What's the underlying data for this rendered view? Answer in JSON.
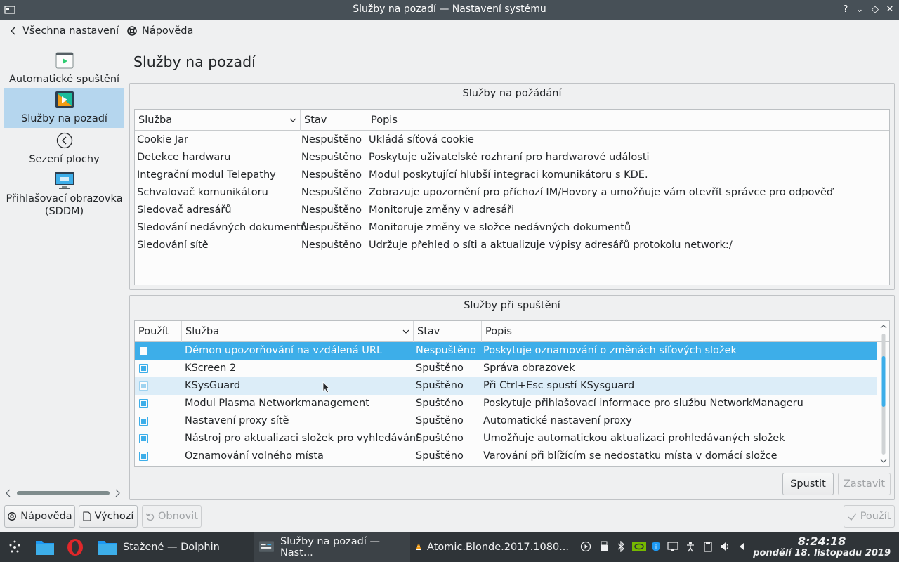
{
  "window": {
    "title": "Služby na pozadí — Nastavení systému",
    "controls": [
      "?",
      "⌄",
      "◇",
      "✕"
    ]
  },
  "topnav": {
    "back_label": "Všechna nastavení",
    "help_label": "Nápověda"
  },
  "sidebar": {
    "items": [
      {
        "label": "Automatické spuštění",
        "icon": "autostart-icon"
      },
      {
        "label": "Služby na pozadí",
        "icon": "background-services-icon",
        "active": true
      },
      {
        "label": "Sezení plochy",
        "icon": "session-icon"
      },
      {
        "label": "Přihlašovací obrazovka (SDDM)",
        "icon": "login-screen-icon"
      }
    ]
  },
  "page": {
    "title": "Služby na pozadí"
  },
  "on_demand": {
    "title": "Služby na požádání",
    "headers": {
      "service": "Služba",
      "state": "Stav",
      "desc": "Popis"
    },
    "rows": [
      {
        "service": "Cookie Jar",
        "state": "Nespuštěno",
        "desc": "Ukládá síťová cookie"
      },
      {
        "service": "Detekce hardwaru",
        "state": "Nespuštěno",
        "desc": "Poskytuje uživatelské rozhraní pro hardwarové události"
      },
      {
        "service": "Integrační modul Telepathy",
        "state": "Nespuštěno",
        "desc": "Modul poskytující hlubší integraci komunikátoru s KDE."
      },
      {
        "service": "Schvalovač komunikátoru",
        "state": "Nespuštěno",
        "desc": "Zobrazuje upozornění pro příchozí IM/Hovory a umožňuje vám otevřít správce pro odpověď"
      },
      {
        "service": "Sledovač adresářů",
        "state": "Nespuštěno",
        "desc": "Monitoruje změny v adresáři"
      },
      {
        "service": "Sledování nedávných dokumentů",
        "state": "Nespuštěno",
        "desc": "Monitoruje změny ve složce nedávných dokumentů"
      },
      {
        "service": "Sledování sítě",
        "state": "Nespuštěno",
        "desc": "Udržuje přehled o síti a aktualizuje výpisy adresářů protokolu network:/"
      }
    ]
  },
  "startup": {
    "title": "Služby při spuštění",
    "headers": {
      "use": "Použít",
      "service": "Služba",
      "state": "Stav",
      "desc": "Popis"
    },
    "rows": [
      {
        "use": false,
        "service": "Démon upozorňování na vzdálená URL",
        "state": "Nespuštěno",
        "desc": "Poskytuje oznamování o změnách síťových složek"
      },
      {
        "use": true,
        "service": "KScreen 2",
        "state": "Spuštěno",
        "desc": "Správa obrazovek"
      },
      {
        "use": true,
        "service": "KSysGuard",
        "state": "Spuštěno",
        "desc": "Při Ctrl+Esc spustí KSysguard"
      },
      {
        "use": true,
        "service": "Modul Plasma Networkmanagement",
        "state": "Spuštěno",
        "desc": "Poskytuje přihlašovací informace pro službu NetworkManageru"
      },
      {
        "use": true,
        "service": "Nastavení proxy sítě",
        "state": "Spuštěno",
        "desc": "Automatické nastavení proxy"
      },
      {
        "use": true,
        "service": "Nástroj pro aktualizaci složek pro vyhledávání",
        "state": "Spuštěno",
        "desc": "Umožňuje automatickou aktualizaci prohledávaných složek"
      },
      {
        "use": true,
        "service": "Oznamování volného místa",
        "state": "Spuštěno",
        "desc": "Varování při blížícím se nedostatku místa v domácí složce"
      }
    ],
    "start_label": "Spustit",
    "stop_label": "Zastavit"
  },
  "footer": {
    "help_label": "Nápověda",
    "defaults_label": "Výchozí",
    "reset_label": "Obnovit",
    "apply_label": "Použít"
  },
  "taskbar": {
    "tasks": [
      {
        "label": "Stažené — Dolphin"
      },
      {
        "label": "Služby na pozadí  — Nast..."
      },
      {
        "label": "Atomic.Blonde.2017.1080..."
      }
    ],
    "time": "8:24:18",
    "date": "pondělí 18. listopadu 2019"
  },
  "colors": {
    "accent": "#3daee9",
    "titlebar": "#475057",
    "taskbar": "#2f3438",
    "sidebar_active": "#b5d6ee"
  }
}
